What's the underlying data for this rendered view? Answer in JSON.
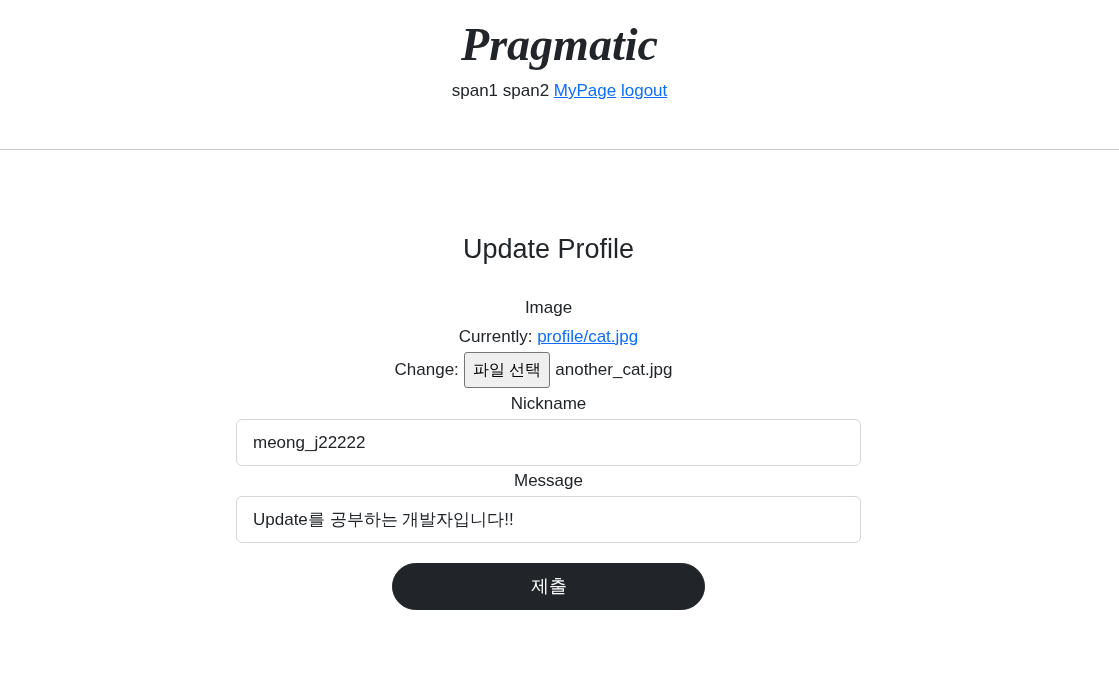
{
  "header": {
    "logo": "Pragmatic",
    "nav": [
      {
        "kind": "text",
        "label": "span1"
      },
      {
        "kind": "text",
        "label": "span2"
      },
      {
        "kind": "link",
        "label": "MyPage"
      },
      {
        "kind": "link",
        "label": "logout"
      }
    ]
  },
  "form": {
    "title": "Update Profile",
    "image": {
      "label": "Image",
      "currently_label": "Currently:",
      "current_file": "profile/cat.jpg",
      "change_label": "Change:",
      "choose_button": "파일 선택",
      "chosen_file": "another_cat.jpg"
    },
    "fields": [
      {
        "label": "Nickname",
        "value": "meong_j22222"
      },
      {
        "label": "Message",
        "value": "Update를 공부하는 개발자입니다!!"
      }
    ],
    "submit": "제출"
  }
}
